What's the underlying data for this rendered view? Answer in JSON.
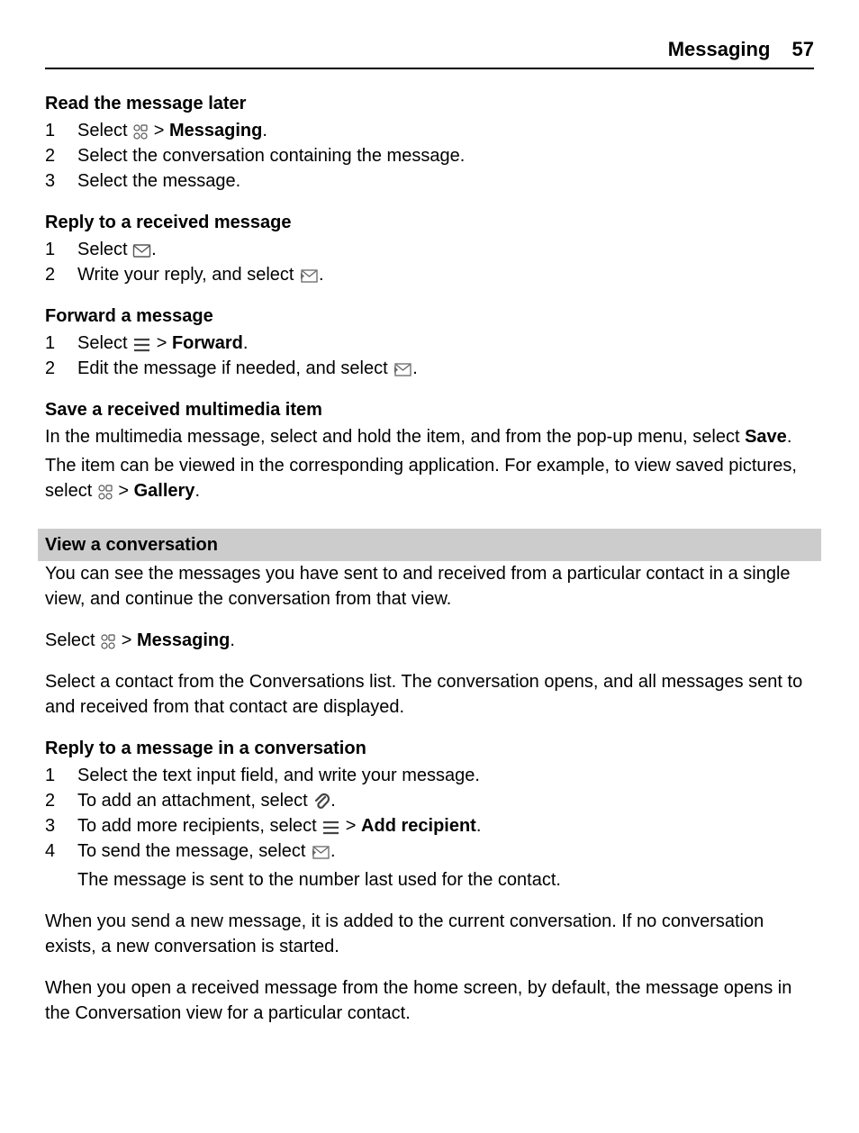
{
  "header": {
    "title": "Messaging",
    "page": "57"
  },
  "s1": {
    "title": "Read the message later",
    "items": [
      {
        "n": "1",
        "pre": "Select ",
        "post": " > ",
        "bold": "Messaging",
        "dot": "."
      },
      {
        "n": "2",
        "text": "Select the conversation containing the message."
      },
      {
        "n": "3",
        "text": "Select the message."
      }
    ]
  },
  "s2": {
    "title": "Reply to a received message",
    "items": [
      {
        "n": "1",
        "pre": "Select ",
        "post": "."
      },
      {
        "n": "2",
        "pre": "Write your reply, and select ",
        "post": "."
      }
    ]
  },
  "s3": {
    "title": "Forward a message",
    "items": [
      {
        "n": "1",
        "pre": "Select ",
        "post": " > ",
        "bold": "Forward",
        "dot": "."
      },
      {
        "n": "2",
        "pre": "Edit the message if needed, and select ",
        "post": "."
      }
    ]
  },
  "s4": {
    "title": "Save a received multimedia item",
    "p1a": "In the multimedia message, select and hold the item, and from the pop-up menu, select ",
    "p1b": "Save",
    "p1c": ".",
    "p2a": "The item can be viewed in the corresponding application. For example, to view saved pictures, select ",
    "p2b": " > ",
    "p2c": "Gallery",
    "p2d": "."
  },
  "s5": {
    "title": "View a conversation",
    "p1": "You can see the messages you have sent to and received from a particular contact in a single view, and continue the conversation from that view.",
    "p2a": "Select ",
    "p2b": " > ",
    "p2c": "Messaging",
    "p2d": ".",
    "p3": "Select a contact from the Conversations list. The conversation opens, and all messages sent to and received from that contact are displayed."
  },
  "s6": {
    "title": "Reply to a message in a conversation",
    "items": [
      {
        "n": "1",
        "text": "Select the text input field, and write your message."
      },
      {
        "n": "2",
        "pre": "To add an attachment, select ",
        "post": "."
      },
      {
        "n": "3",
        "pre": "To add more recipients, select ",
        "post": " > ",
        "bold": "Add recipient",
        "dot": "."
      },
      {
        "n": "4",
        "pre": "To send the message, select ",
        "post": "."
      }
    ],
    "note": "The message is sent to the number last used for the contact."
  },
  "p_end1": "When you send a new message, it is added to the current conversation. If no conversation exists, a new conversation is started.",
  "p_end2": "When you open a received message from the home screen, by default, the message opens in the Conversation view for a particular contact."
}
